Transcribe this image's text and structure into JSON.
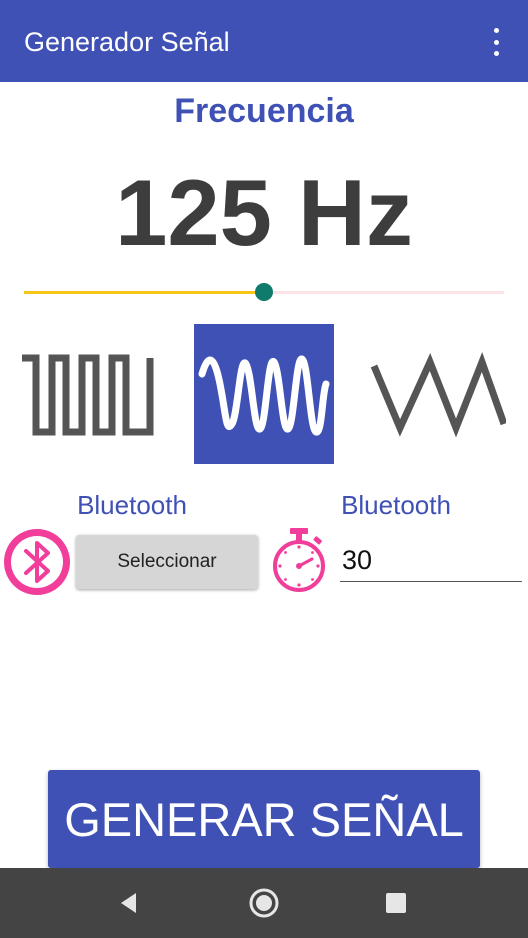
{
  "app_bar": {
    "title": "Generador Señal",
    "menu_icon": "more-vert-icon",
    "color": "#3f51b5"
  },
  "frequency": {
    "label": "Frecuencia",
    "value_text": "125 Hz",
    "slider_fraction": 0.5,
    "slider_active_color": "#f5c518",
    "slider_thumb_color": "#0f7b6c"
  },
  "waveforms": {
    "options": [
      "square-wave-icon",
      "sine-wave-icon",
      "triangle-wave-icon"
    ],
    "selected": "sine-wave-icon"
  },
  "bluetooth": {
    "label": "Bluetooth",
    "icon": "bluetooth-icon",
    "select_button_label": "Seleccionar"
  },
  "timer": {
    "label": "Bluetooth",
    "icon": "stopwatch-icon",
    "value": "30"
  },
  "generate_button_label": "GENERAR SEÑAL",
  "nav_bar": {
    "icons": [
      "back-icon",
      "home-icon",
      "recents-icon"
    ]
  },
  "colors": {
    "primary": "#3f51b5",
    "accent_pink": "#f03e9a",
    "wave_gray": "#555555"
  }
}
